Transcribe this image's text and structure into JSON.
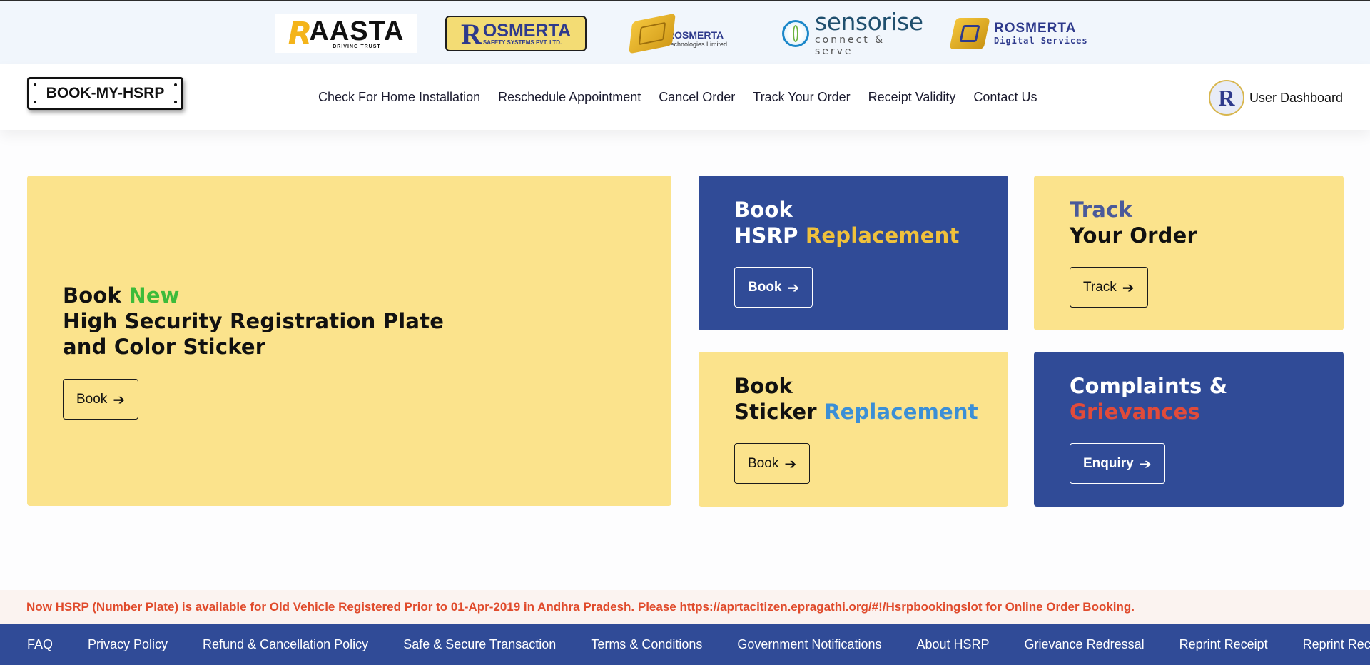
{
  "logos": {
    "aasta": {
      "mark": "R",
      "name": "AASTA",
      "tagline": "DRIVING TRUST"
    },
    "rosmerta_safety": {
      "mark": "R",
      "name": "OSMERTA",
      "tagline": "SAFETY SYSTEMS PVT. LTD."
    },
    "rosmerta_tech": {
      "name": "ROSMERTA",
      "tagline": "Technologies Limited"
    },
    "sensorise": {
      "name": "sensorise",
      "tagline": "connect & serve"
    },
    "rosmerta_digital": {
      "name": "ROSMERTA",
      "tagline": "Digital Services"
    }
  },
  "header": {
    "brand": "BOOK-MY-HSRP",
    "nav": [
      "Check For Home Installation",
      "Reschedule Appointment",
      "Cancel Order",
      "Track Your Order",
      "Receipt Validity",
      "Contact Us"
    ],
    "user_avatar_letter": "R",
    "user_dashboard": "User Dashboard"
  },
  "cards": {
    "book_new": {
      "line1_prefix": "Book ",
      "line1_highlight": "New",
      "line2": "High Security Registration Plate",
      "line3": "and Color Sticker",
      "button": "Book",
      "highlight_color": "#3dbb3a"
    },
    "hsrp_replacement": {
      "line1": "Book",
      "line2_prefix": "HSRP ",
      "line2_highlight": "Replacement",
      "button": "Book",
      "highlight_color": "#f0c13b"
    },
    "track_order": {
      "line1": "Track",
      "line2": "Your Order",
      "button": "Track",
      "line1_color": "#4a5a9a"
    },
    "sticker_replacement": {
      "line1": "Book",
      "line2_prefix": "Sticker ",
      "line2_highlight": "Replacement",
      "button": "Book",
      "highlight_color": "#3b8fd6"
    },
    "complaints": {
      "line1": "Complaints &",
      "line2": "Grievances",
      "button": "Enquiry",
      "line2_color": "#e14b3a"
    }
  },
  "notice": "Now HSRP (Number Plate) is available for Old Vehicle Registered Prior to 01-Apr-2019 in Andhra Pradesh. Please https://aprtacitizen.epragathi.org/#!/Hsrpbookingslot for Online Order Booking.",
  "footer": [
    "FAQ",
    "Privacy Policy",
    "Refund & Cancellation Policy",
    "Safe & Secure Transaction",
    "Terms & Conditions",
    "Government Notifications",
    "About HSRP",
    "Grievance Redressal",
    "Reprint Receipt",
    "Reprint Receipt"
  ],
  "colors": {
    "primary_blue": "#304b97",
    "card_yellow": "#fbe38c",
    "notice_red": "#e04b2c"
  },
  "icons": {
    "button_arrow": "arrow-right-icon"
  }
}
